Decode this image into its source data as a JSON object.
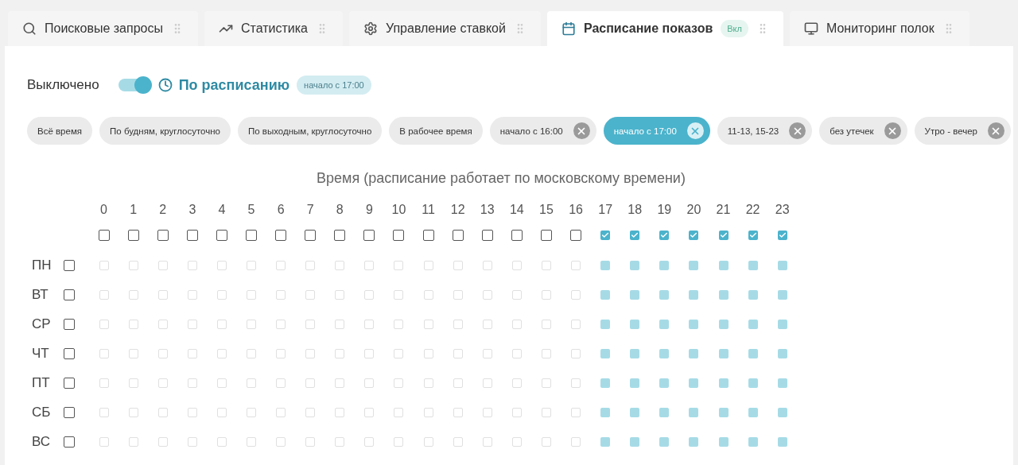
{
  "tabs": [
    {
      "label": "Поисковые запросы",
      "kind": "search",
      "selected": false
    },
    {
      "label": "Статистика",
      "kind": "stats",
      "selected": false
    },
    {
      "label": "Управление ставкой",
      "kind": "bid",
      "selected": false
    },
    {
      "label": "Расписание показов",
      "kind": "schedule",
      "selected": true,
      "badge": "Вкл"
    },
    {
      "label": "Мониторинг полок",
      "kind": "monitoring",
      "selected": false
    }
  ],
  "status": {
    "label": "Выключено",
    "on": true,
    "mode": "По расписанию",
    "badge": "начало с 17:00"
  },
  "presets": [
    {
      "label": "Всё время",
      "selected": false,
      "removable": false
    },
    {
      "label": "По будням, круглосуточно",
      "selected": false,
      "removable": false
    },
    {
      "label": "По выходным, круглосуточно",
      "selected": false,
      "removable": false
    },
    {
      "label": "В рабочее время",
      "selected": false,
      "removable": false
    },
    {
      "label": "начало с 16:00",
      "selected": false,
      "removable": true
    },
    {
      "label": "начало с 17:00",
      "selected": true,
      "removable": true
    },
    {
      "label": "11-13, 15-23",
      "selected": false,
      "removable": true
    },
    {
      "label": "без утечек",
      "selected": false,
      "removable": true
    },
    {
      "label": "Утро - вечер",
      "selected": false,
      "removable": true
    }
  ],
  "schedule": {
    "title": "Время (расписание работает по московскому времени)",
    "hours": [
      {
        "label": "0",
        "checked": false
      },
      {
        "label": "1",
        "checked": false
      },
      {
        "label": "2",
        "checked": false
      },
      {
        "label": "3",
        "checked": false
      },
      {
        "label": "4",
        "checked": false
      },
      {
        "label": "5",
        "checked": false
      },
      {
        "label": "6",
        "checked": false
      },
      {
        "label": "7",
        "checked": false
      },
      {
        "label": "8",
        "checked": false
      },
      {
        "label": "9",
        "checked": false
      },
      {
        "label": "10",
        "checked": false
      },
      {
        "label": "11",
        "checked": false
      },
      {
        "label": "12",
        "checked": false
      },
      {
        "label": "13",
        "checked": false
      },
      {
        "label": "14",
        "checked": false
      },
      {
        "label": "15",
        "checked": false
      },
      {
        "label": "16",
        "checked": false
      },
      {
        "label": "17",
        "checked": true
      },
      {
        "label": "18",
        "checked": true
      },
      {
        "label": "19",
        "checked": true
      },
      {
        "label": "20",
        "checked": true
      },
      {
        "label": "21",
        "checked": true
      },
      {
        "label": "22",
        "checked": true
      },
      {
        "label": "23",
        "checked": true
      }
    ],
    "days": [
      {
        "label": "ПН",
        "checked": false,
        "cells": [
          false,
          false,
          false,
          false,
          false,
          false,
          false,
          false,
          false,
          false,
          false,
          false,
          false,
          false,
          false,
          false,
          false,
          true,
          true,
          true,
          true,
          true,
          true,
          true
        ]
      },
      {
        "label": "ВТ",
        "checked": false,
        "cells": [
          false,
          false,
          false,
          false,
          false,
          false,
          false,
          false,
          false,
          false,
          false,
          false,
          false,
          false,
          false,
          false,
          false,
          true,
          true,
          true,
          true,
          true,
          true,
          true
        ]
      },
      {
        "label": "СР",
        "checked": false,
        "cells": [
          false,
          false,
          false,
          false,
          false,
          false,
          false,
          false,
          false,
          false,
          false,
          false,
          false,
          false,
          false,
          false,
          false,
          true,
          true,
          true,
          true,
          true,
          true,
          true
        ]
      },
      {
        "label": "ЧТ",
        "checked": false,
        "cells": [
          false,
          false,
          false,
          false,
          false,
          false,
          false,
          false,
          false,
          false,
          false,
          false,
          false,
          false,
          false,
          false,
          false,
          true,
          true,
          true,
          true,
          true,
          true,
          true
        ]
      },
      {
        "label": "ПТ",
        "checked": false,
        "cells": [
          false,
          false,
          false,
          false,
          false,
          false,
          false,
          false,
          false,
          false,
          false,
          false,
          false,
          false,
          false,
          false,
          false,
          true,
          true,
          true,
          true,
          true,
          true,
          true
        ]
      },
      {
        "label": "СБ",
        "checked": false,
        "cells": [
          false,
          false,
          false,
          false,
          false,
          false,
          false,
          false,
          false,
          false,
          false,
          false,
          false,
          false,
          false,
          false,
          false,
          true,
          true,
          true,
          true,
          true,
          true,
          true
        ]
      },
      {
        "label": "ВС",
        "checked": false,
        "cells": [
          false,
          false,
          false,
          false,
          false,
          false,
          false,
          false,
          false,
          false,
          false,
          false,
          false,
          false,
          false,
          false,
          false,
          true,
          true,
          true,
          true,
          true,
          true,
          true
        ]
      }
    ]
  }
}
